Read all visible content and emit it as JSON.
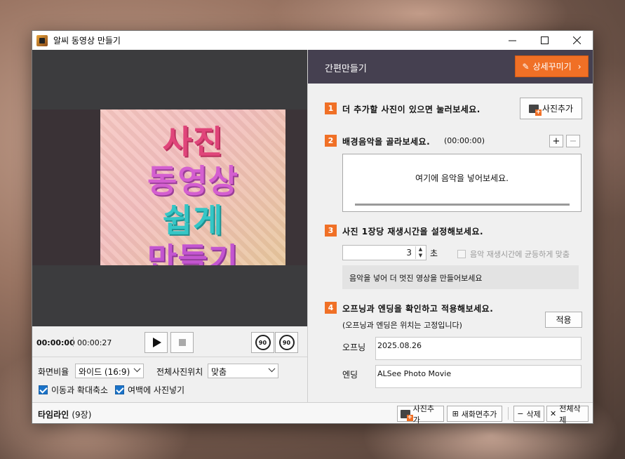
{
  "window": {
    "title": "알씨 동영상 만들기"
  },
  "preview": {
    "photo_lines": [
      "사진",
      "동영상",
      "쉽게",
      "만들기"
    ],
    "time_current": "00:00:00",
    "time_total": "00:00:27",
    "rotate_left_label": "90",
    "rotate_right_label": "90"
  },
  "options": {
    "aspect_label": "화면비율",
    "aspect_value": "와이드 (16:9)",
    "position_label": "전체사진위치",
    "position_value": "맞춤",
    "checkbox_motion": "이동과 확대축소",
    "checkbox_margin": "여백에 사진넣기"
  },
  "panel": {
    "title": "간편만들기",
    "detail_button": "상세꾸미기",
    "step1": {
      "num": "1",
      "text": "더 추가할 사진이 있으면 눌러보세요.",
      "button": "사진추가"
    },
    "step2": {
      "num": "2",
      "text": "배경음악을 골라보세요.",
      "duration": "(00:00:00)",
      "add": "+",
      "remove": "−",
      "placeholder": "여기에 음악을 넣어보세요."
    },
    "step3": {
      "num": "3",
      "text": "사진 1장당 재생시간을 설정해보세요.",
      "seconds_value": "3",
      "seconds_unit": "초",
      "sync_label": "음악 재생시간에 균등하게 맞춤",
      "hint": "음악을 넣어 더 멋진 영상을 만들어보세요"
    },
    "step4": {
      "num": "4",
      "text": "오프닝과 엔딩을 확인하고 적용해보세요.",
      "subtext": "(오프닝과 엔딩은 위치는 고정입니다)",
      "apply_button": "적용",
      "opening_label": "오프닝",
      "opening_value": "2025.08.26",
      "ending_label": "엔딩",
      "ending_value": "ALSee Photo Movie"
    }
  },
  "timeline": {
    "title": "타임라인",
    "count": "(9장)",
    "add_photo": "사진추가",
    "add_screen": "새화면추가",
    "delete": "삭제",
    "delete_all": "전체삭제"
  },
  "colors": {
    "accent": "#f07026",
    "header": "#454050",
    "preview_bg": "#3c3c3e",
    "check": "#1a73c9"
  }
}
